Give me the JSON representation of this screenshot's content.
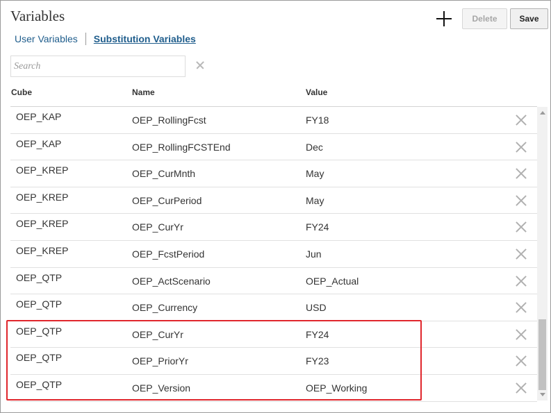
{
  "page": {
    "title": "Variables"
  },
  "toolbar": {
    "add_icon": "plus-icon",
    "delete_label": "Delete",
    "save_label": "Save"
  },
  "tabs": {
    "user": "User Variables",
    "substitution": "Substitution Variables",
    "active": "substitution"
  },
  "search": {
    "placeholder": "Search",
    "value": ""
  },
  "columns": {
    "cube": "Cube",
    "name": "Name",
    "value": "Value"
  },
  "rows": [
    {
      "cube": "OEP_KAP",
      "name": "OEP_RollingFcst",
      "value": "FY18"
    },
    {
      "cube": "OEP_KAP",
      "name": "OEP_RollingFCSTEnd",
      "value": "Dec"
    },
    {
      "cube": "OEP_KREP",
      "name": "OEP_CurMnth",
      "value": "May"
    },
    {
      "cube": "OEP_KREP",
      "name": "OEP_CurPeriod",
      "value": "May"
    },
    {
      "cube": "OEP_KREP",
      "name": "OEP_CurYr",
      "value": "FY24"
    },
    {
      "cube": "OEP_KREP",
      "name": "OEP_FcstPeriod",
      "value": "Jun"
    },
    {
      "cube": "OEP_QTP",
      "name": "OEP_ActScenario",
      "value": "OEP_Actual"
    },
    {
      "cube": "OEP_QTP",
      "name": "OEP_Currency",
      "value": "USD"
    },
    {
      "cube": "OEP_QTP",
      "name": "OEP_CurYr",
      "value": "FY24"
    },
    {
      "cube": "OEP_QTP",
      "name": "OEP_PriorYr",
      "value": "FY23"
    },
    {
      "cube": "OEP_QTP",
      "name": "OEP_Version",
      "value": "OEP_Working"
    }
  ],
  "colors": {
    "link": "#1f5d8c",
    "highlight": "#e0262c"
  }
}
